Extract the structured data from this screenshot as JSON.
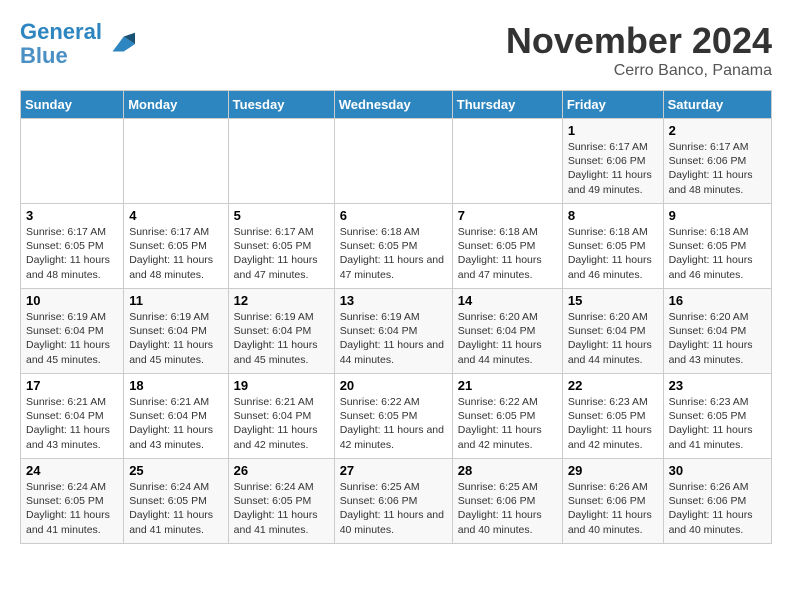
{
  "header": {
    "logo_line1": "General",
    "logo_line2": "Blue",
    "month_title": "November 2024",
    "subtitle": "Cerro Banco, Panama"
  },
  "weekdays": [
    "Sunday",
    "Monday",
    "Tuesday",
    "Wednesday",
    "Thursday",
    "Friday",
    "Saturday"
  ],
  "weeks": [
    [
      {
        "day": "",
        "info": ""
      },
      {
        "day": "",
        "info": ""
      },
      {
        "day": "",
        "info": ""
      },
      {
        "day": "",
        "info": ""
      },
      {
        "day": "",
        "info": ""
      },
      {
        "day": "1",
        "info": "Sunrise: 6:17 AM\nSunset: 6:06 PM\nDaylight: 11 hours and 49 minutes."
      },
      {
        "day": "2",
        "info": "Sunrise: 6:17 AM\nSunset: 6:06 PM\nDaylight: 11 hours and 48 minutes."
      }
    ],
    [
      {
        "day": "3",
        "info": "Sunrise: 6:17 AM\nSunset: 6:05 PM\nDaylight: 11 hours and 48 minutes."
      },
      {
        "day": "4",
        "info": "Sunrise: 6:17 AM\nSunset: 6:05 PM\nDaylight: 11 hours and 48 minutes."
      },
      {
        "day": "5",
        "info": "Sunrise: 6:17 AM\nSunset: 6:05 PM\nDaylight: 11 hours and 47 minutes."
      },
      {
        "day": "6",
        "info": "Sunrise: 6:18 AM\nSunset: 6:05 PM\nDaylight: 11 hours and 47 minutes."
      },
      {
        "day": "7",
        "info": "Sunrise: 6:18 AM\nSunset: 6:05 PM\nDaylight: 11 hours and 47 minutes."
      },
      {
        "day": "8",
        "info": "Sunrise: 6:18 AM\nSunset: 6:05 PM\nDaylight: 11 hours and 46 minutes."
      },
      {
        "day": "9",
        "info": "Sunrise: 6:18 AM\nSunset: 6:05 PM\nDaylight: 11 hours and 46 minutes."
      }
    ],
    [
      {
        "day": "10",
        "info": "Sunrise: 6:19 AM\nSunset: 6:04 PM\nDaylight: 11 hours and 45 minutes."
      },
      {
        "day": "11",
        "info": "Sunrise: 6:19 AM\nSunset: 6:04 PM\nDaylight: 11 hours and 45 minutes."
      },
      {
        "day": "12",
        "info": "Sunrise: 6:19 AM\nSunset: 6:04 PM\nDaylight: 11 hours and 45 minutes."
      },
      {
        "day": "13",
        "info": "Sunrise: 6:19 AM\nSunset: 6:04 PM\nDaylight: 11 hours and 44 minutes."
      },
      {
        "day": "14",
        "info": "Sunrise: 6:20 AM\nSunset: 6:04 PM\nDaylight: 11 hours and 44 minutes."
      },
      {
        "day": "15",
        "info": "Sunrise: 6:20 AM\nSunset: 6:04 PM\nDaylight: 11 hours and 44 minutes."
      },
      {
        "day": "16",
        "info": "Sunrise: 6:20 AM\nSunset: 6:04 PM\nDaylight: 11 hours and 43 minutes."
      }
    ],
    [
      {
        "day": "17",
        "info": "Sunrise: 6:21 AM\nSunset: 6:04 PM\nDaylight: 11 hours and 43 minutes."
      },
      {
        "day": "18",
        "info": "Sunrise: 6:21 AM\nSunset: 6:04 PM\nDaylight: 11 hours and 43 minutes."
      },
      {
        "day": "19",
        "info": "Sunrise: 6:21 AM\nSunset: 6:04 PM\nDaylight: 11 hours and 42 minutes."
      },
      {
        "day": "20",
        "info": "Sunrise: 6:22 AM\nSunset: 6:05 PM\nDaylight: 11 hours and 42 minutes."
      },
      {
        "day": "21",
        "info": "Sunrise: 6:22 AM\nSunset: 6:05 PM\nDaylight: 11 hours and 42 minutes."
      },
      {
        "day": "22",
        "info": "Sunrise: 6:23 AM\nSunset: 6:05 PM\nDaylight: 11 hours and 42 minutes."
      },
      {
        "day": "23",
        "info": "Sunrise: 6:23 AM\nSunset: 6:05 PM\nDaylight: 11 hours and 41 minutes."
      }
    ],
    [
      {
        "day": "24",
        "info": "Sunrise: 6:24 AM\nSunset: 6:05 PM\nDaylight: 11 hours and 41 minutes."
      },
      {
        "day": "25",
        "info": "Sunrise: 6:24 AM\nSunset: 6:05 PM\nDaylight: 11 hours and 41 minutes."
      },
      {
        "day": "26",
        "info": "Sunrise: 6:24 AM\nSunset: 6:05 PM\nDaylight: 11 hours and 41 minutes."
      },
      {
        "day": "27",
        "info": "Sunrise: 6:25 AM\nSunset: 6:06 PM\nDaylight: 11 hours and 40 minutes."
      },
      {
        "day": "28",
        "info": "Sunrise: 6:25 AM\nSunset: 6:06 PM\nDaylight: 11 hours and 40 minutes."
      },
      {
        "day": "29",
        "info": "Sunrise: 6:26 AM\nSunset: 6:06 PM\nDaylight: 11 hours and 40 minutes."
      },
      {
        "day": "30",
        "info": "Sunrise: 6:26 AM\nSunset: 6:06 PM\nDaylight: 11 hours and 40 minutes."
      }
    ]
  ]
}
